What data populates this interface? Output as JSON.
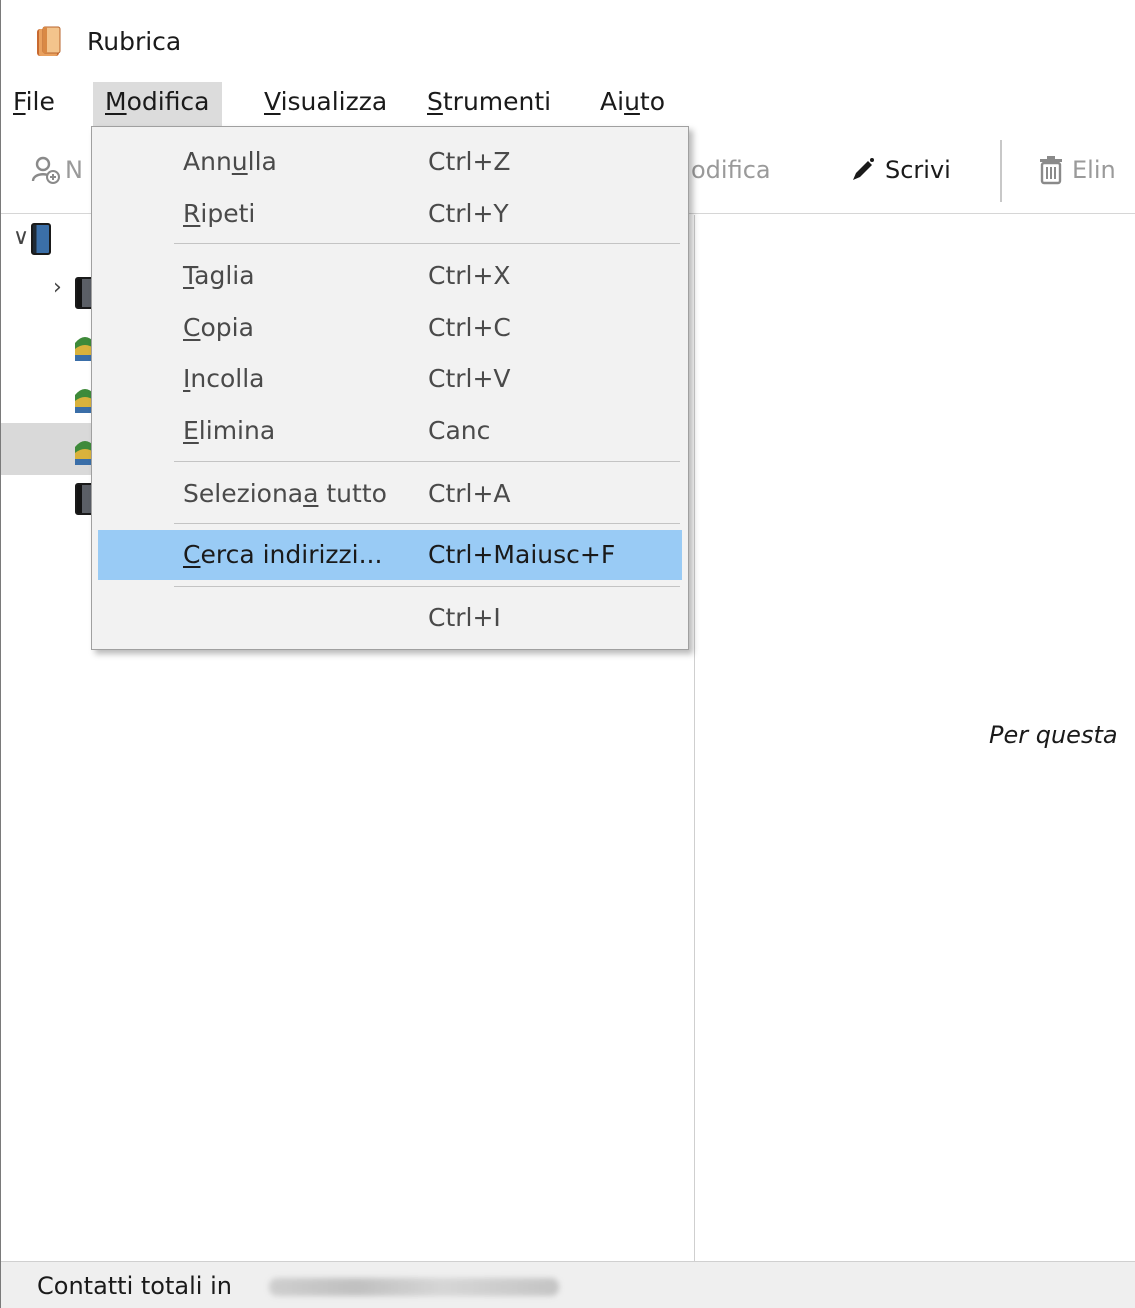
{
  "window": {
    "title": "Rubrica"
  },
  "menubar": {
    "items": [
      {
        "pre": "",
        "u": "F",
        "post": "ile"
      },
      {
        "pre": "",
        "u": "M",
        "post": "odifica"
      },
      {
        "pre": "",
        "u": "V",
        "post": "isualizza"
      },
      {
        "pre": "",
        "u": "S",
        "post": "trumenti"
      },
      {
        "pre": "Ai",
        "u": "u",
        "post": "to"
      }
    ]
  },
  "toolbar": {
    "new_contact_label_fragment": "N",
    "edit_label_fragment": "odifica",
    "write_label": "Scrivi",
    "delete_label_fragment": "Elin"
  },
  "edit_menu": {
    "undo": {
      "pre": "Ann",
      "u": "u",
      "post": "lla",
      "shortcut": "Ctrl+Z"
    },
    "redo": {
      "pre": "",
      "u": "R",
      "post": "ipeti",
      "shortcut": "Ctrl+Y"
    },
    "cut": {
      "pre": "",
      "u": "T",
      "post": "aglia",
      "shortcut": "Ctrl+X"
    },
    "copy": {
      "pre": "",
      "u": "C",
      "post": "opia",
      "shortcut": "Ctrl+C"
    },
    "paste": {
      "pre": "",
      "u": "I",
      "post": "ncolla",
      "shortcut": "Ctrl+V"
    },
    "delete": {
      "pre": "",
      "u": "E",
      "post": "limina",
      "shortcut": "Canc"
    },
    "select_all": {
      "pre": "Seleziona",
      "u": "a",
      "post": " tutto",
      "shortcut": "Ctrl+A"
    },
    "search_addresses": {
      "pre": "",
      "u": "C",
      "post": "erca indirizzi...",
      "shortcut": "Ctrl+Maiusc+F"
    },
    "blank_item": {
      "label": "",
      "shortcut": "Ctrl+I"
    }
  },
  "content": {
    "empty_message": "Per questa"
  },
  "statusbar": {
    "text": "Contatti totali in"
  }
}
